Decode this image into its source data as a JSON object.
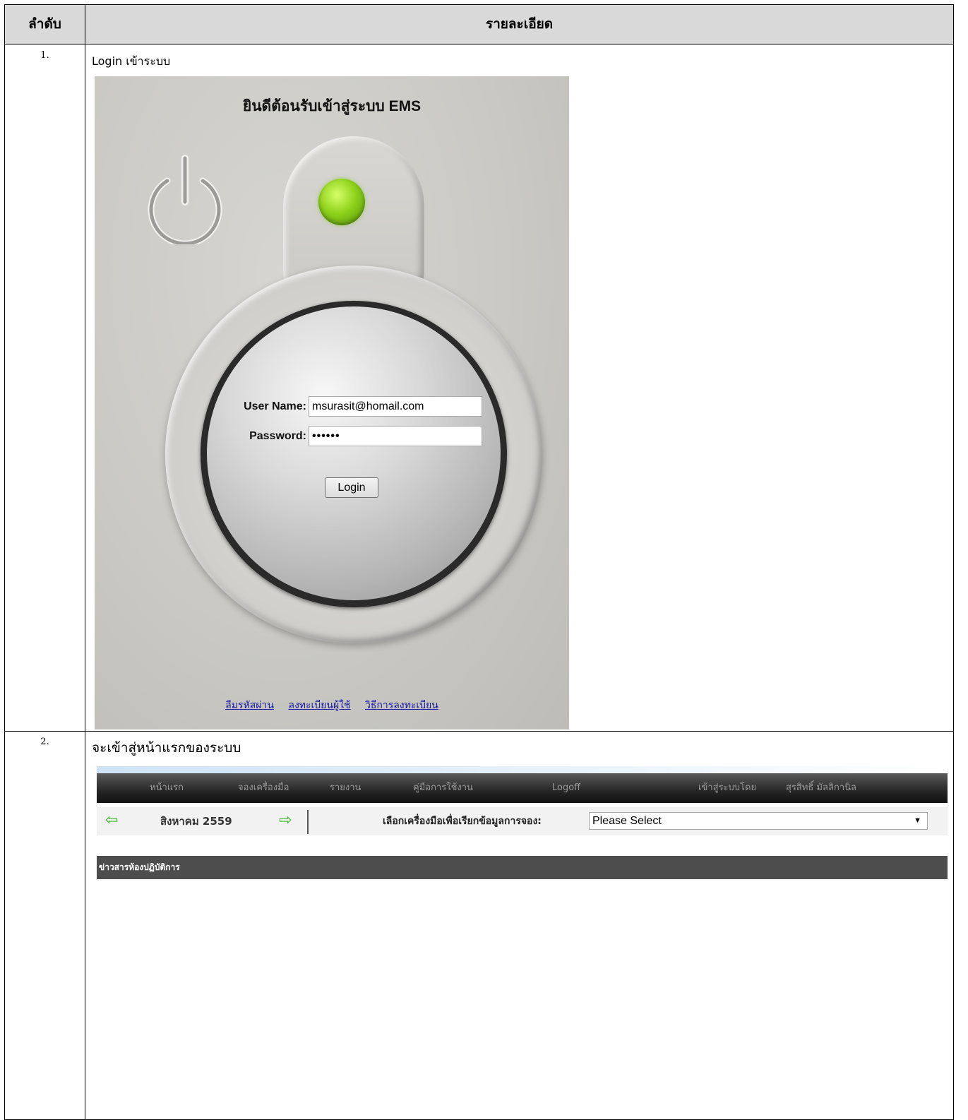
{
  "table": {
    "header_num": "ลำดับ",
    "header_detail": "รายละเอียด"
  },
  "steps": [
    {
      "num": "1.",
      "text": "Login เข้าระบบ"
    },
    {
      "num": "2.",
      "text": "จะเข้าสู่หน้าแรกของระบบ"
    }
  ],
  "login": {
    "title": "ยินดีต้อนรับเข้าสู่ระบบ EMS",
    "username_label": "User Name:",
    "username_value": "msurasit@homail.com",
    "password_label": "Password:",
    "password_value": "••••••",
    "button_label": "Login",
    "links": [
      "ลืมรหัสผ่าน",
      "ลงทะเบียนผู้ใช้",
      "วิธีการลงทะเบียน"
    ],
    "led_color": "#8fd21b"
  },
  "home": {
    "nav": [
      "หน้าแรก",
      "จองเครื่องมือ",
      "รายงาน",
      "คู่มือการใช้งาน",
      "Logoff"
    ],
    "logged_in_label": "เข้าสู่ระบบโดย",
    "user_name": "สุรสิทธิ์ มัลลิกานิล",
    "prev_icon": "arrow-left-icon",
    "next_icon": "arrow-right-icon",
    "month": "สิงหาคม 2559",
    "select_label": "เลือกเครื่องมือเพื่อเรียกข้อมูลการจอง:",
    "select_value": "Please Select",
    "news_title": "ข่าวสารห้องปฏิบัติการ"
  }
}
